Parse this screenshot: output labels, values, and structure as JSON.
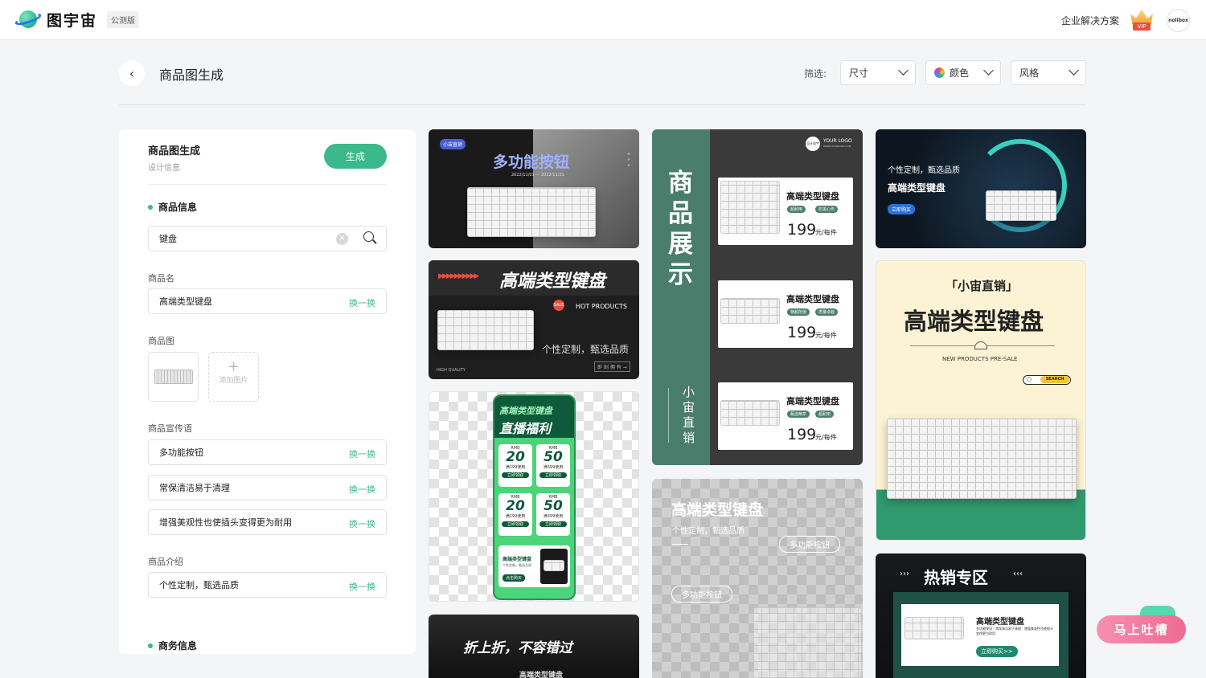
{
  "topbar": {
    "logo_text": "图宇宙",
    "badge": "公测版",
    "enterprise_link": "企业解决方案",
    "vip_label": "VIP",
    "avatar_text": "nolibox"
  },
  "header": {
    "back": "‹",
    "title": "商品图生成",
    "filter_label": "筛选:",
    "filters": {
      "size": "尺寸",
      "color": "颜色",
      "style": "风格"
    }
  },
  "panel": {
    "title": "商品图生成",
    "subtitle": "设计信息",
    "generate_label": "生成",
    "product_section": "商品信息",
    "search_value": "键盘",
    "name_label": "商品名",
    "name_value": "高端类型键盘",
    "swap_label": "换一换",
    "image_label": "商品图",
    "add_image_label": "添加图片",
    "slogan_label": "商品宣传语",
    "slogans": [
      "多功能按钮",
      "常保清洁易于清理",
      "增强美观性也使插头变得更为耐用"
    ],
    "intro_label": "商品介绍",
    "intro_value": "个性定制，甄选品质",
    "business_section": "商务信息"
  },
  "cards": {
    "c1": {
      "tag": "小宙直销",
      "title": "多功能按钮",
      "date": "2022/11/01 — 2022/11/21"
    },
    "c2": {
      "title": "高端类型键盘",
      "hot": "HOT PRODUCTS",
      "sub": "个性定制，甄选品质",
      "quality": "HIGH QUALITY",
      "btn": "即 刻 拥 有 →"
    },
    "c3": {
      "title1": "高端类型键盘",
      "title2": "直播福利",
      "coupons": [
        {
          "rmb": "RMB",
          "amount": "20",
          "cond": "满199使用",
          "btn": "立即领取"
        },
        {
          "rmb": "RMB",
          "amount": "50",
          "cond": "满399使用",
          "btn": "立即领取"
        },
        {
          "rmb": "RMB",
          "amount": "20",
          "cond": "满199使用",
          "btn": "立即领取"
        },
        {
          "rmb": "RMB",
          "amount": "50",
          "cond": "满399使用",
          "btn": "立即领取"
        }
      ],
      "product_name": "高端类型键盘",
      "product_sub": "个性定制，甄选品质",
      "buy": "点击购买"
    },
    "c4": {
      "title": "折上折，不容错过",
      "sub": "高端类型键盘"
    },
    "c5": {
      "vtitle": "商品展示",
      "vsub": "小宙直销",
      "logo": "YOUR LOGO",
      "logo_url": "WWW.YOURLOGO.COM",
      "logo_mark": "设计宙宇",
      "items": [
        {
          "name": "高端类型键盘",
          "tags": [
            "超耐用",
            "防黑心伤"
          ],
          "price": "199",
          "unit": "元/每件"
        },
        {
          "name": "高端类型键盘",
          "tags": [
            "物超所值",
            "质量卓越"
          ],
          "price": "199",
          "unit": "元/每件"
        },
        {
          "name": "高端类型键盘",
          "tags": [
            "甄选精享",
            "超耐用"
          ],
          "price": "199",
          "unit": "元/每件"
        }
      ]
    },
    "c6": {
      "title": "高端类型键盘",
      "sub": "个性定制，甄选品质",
      "pill1": "多功能按钮",
      "pill2": "多功能按钮"
    },
    "c7": {
      "line1": "个性定制，甄选品质",
      "line2": "高端类型键盘",
      "btn": "立即购买"
    },
    "c8": {
      "brand": "「小宙直销」",
      "title": "高端类型键盘",
      "sub": "NEW PRODUCTS PRE-SALE",
      "search": "SEARCH"
    },
    "c9": {
      "title": "热销专区",
      "name": "高端类型键盘",
      "desc": "多功能按钮｜常保清洁易于清理｜增强美观性也使插头变得更为耐用",
      "btn": "立即购买>>"
    }
  },
  "feedback": {
    "label": "马上吐槽"
  },
  "colors": {
    "accent": "#3cb88d",
    "dark_card": "#1c1c1c",
    "green_card": "#4a7d6c",
    "cream": "#fbf3d4",
    "pink": "#f06a93"
  }
}
